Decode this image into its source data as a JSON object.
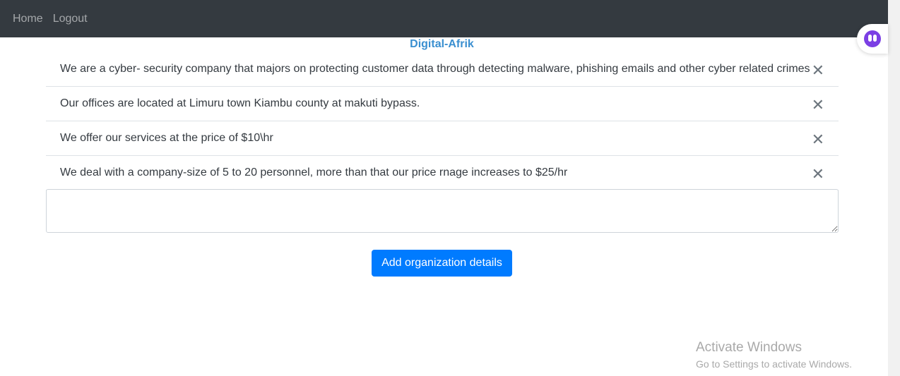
{
  "nav": {
    "links": [
      "Home",
      "Logout"
    ]
  },
  "org": {
    "title": "Digital-Afrik",
    "details": [
      "We are a cyber- security company that majors on protecting customer data through detecting malware, phishing emails and other cyber related crimes",
      "Our offices are located at Limuru town Kiambu county at makuti bypass.",
      "We offer our services at the price of $10\\hr",
      "We deal with a company-size of 5 to 20 personnel, more than that our price rnage increases to $25/hr"
    ],
    "close_glyph": "✕"
  },
  "form": {
    "textarea_value": "",
    "add_label": "Add organization details"
  },
  "watermark": {
    "title": "Activate Windows",
    "subtitle": "Go to Settings to activate Windows."
  },
  "icons": {
    "helper": "assistant-face-icon",
    "close": "close-icon"
  },
  "colors": {
    "navbar": "#343a40",
    "title": "#3a8fd0",
    "button": "#007bff",
    "helper": "#7b3fe4"
  }
}
